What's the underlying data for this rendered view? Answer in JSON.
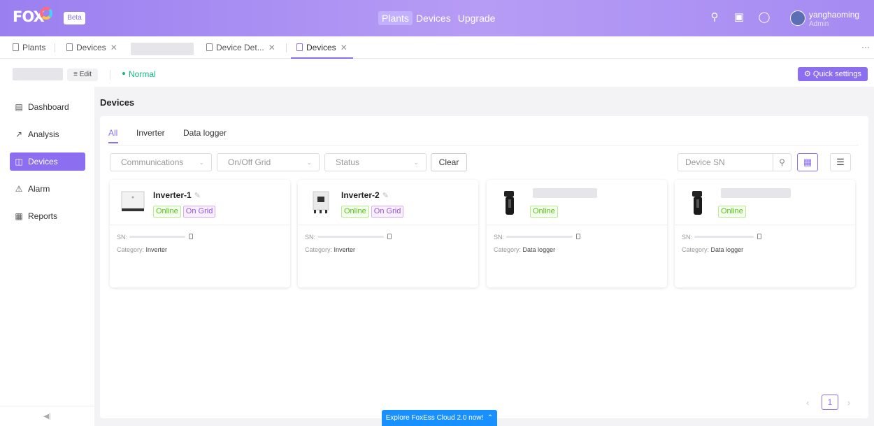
{
  "header": {
    "logo": "FOX",
    "beta": "Beta",
    "nav": [
      "Plants",
      "Devices",
      "Upgrade"
    ],
    "user_name": "yanghaoming",
    "user_role": "Admin"
  },
  "tabs": [
    {
      "label": "Plants"
    },
    {
      "label": "Devices"
    },
    {
      "label": "Device Det..."
    },
    {
      "label": "Devices"
    }
  ],
  "subbar": {
    "edit_label": "Edit",
    "status": "Normal",
    "quick_settings": "Quick settings"
  },
  "sidebar": {
    "items": [
      {
        "label": "Dashboard"
      },
      {
        "label": "Analysis"
      },
      {
        "label": "Devices"
      },
      {
        "label": "Alarm"
      },
      {
        "label": "Reports"
      }
    ]
  },
  "main": {
    "title": "Devices",
    "filter_tabs": [
      "All",
      "Inverter",
      "Data logger"
    ],
    "filters": {
      "communications": "Communications",
      "grid": "On/Off Grid",
      "status": "Status",
      "clear": "Clear",
      "sn_placeholder": "Device SN"
    },
    "cards": [
      {
        "name": "Inverter-1",
        "online": "Online",
        "grid": "On Grid",
        "sn_label": "SN:",
        "category_label": "Category:",
        "category": "Inverter"
      },
      {
        "name": "Inverter-2",
        "online": "Online",
        "grid": "On Grid",
        "sn_label": "SN:",
        "category_label": "Category:",
        "category": "Inverter"
      },
      {
        "name": "",
        "online": "Online",
        "sn_label": "SN:",
        "category_label": "Category:",
        "category": "Data logger"
      },
      {
        "name": "",
        "online": "Online",
        "sn_label": "SN:",
        "category_label": "Category:",
        "category": "Data logger"
      }
    ],
    "pagination": {
      "current": "1"
    }
  },
  "banner": "Explore FoxEss Cloud 2.0 now!",
  "colors": {
    "accent": "#8c6ff0",
    "online": "#52c41a",
    "status_normal": "#12b981",
    "banner": "#1890ff"
  }
}
